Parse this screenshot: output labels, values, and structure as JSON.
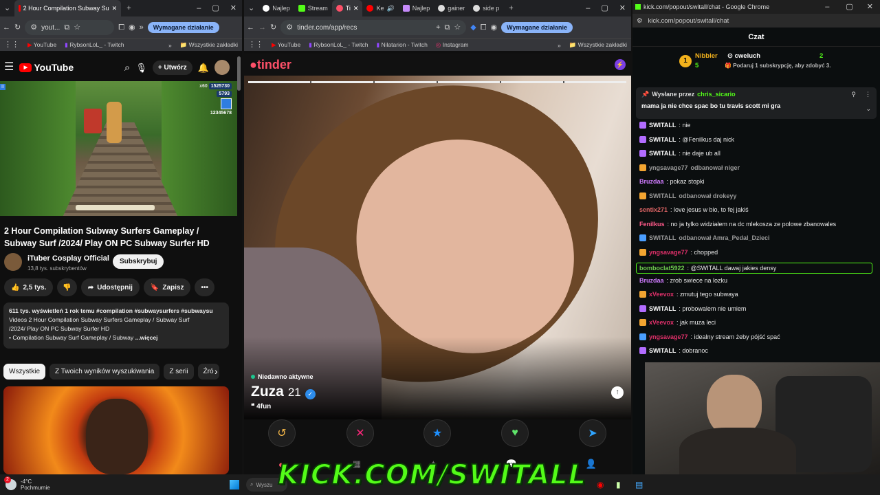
{
  "left_window": {
    "tabs": [
      {
        "label": "2 Hour Compilation Subway Su"
      }
    ],
    "address": "yout...",
    "action_button": "Wymagane działanie",
    "bookmarks": [
      "YouTube",
      "RybsonLoL_ - Twitch"
    ],
    "all_bookmarks": "Wszystkie zakładki",
    "youtube": {
      "logo": "YouTube",
      "create_label": "Utwórz",
      "video_overlay": {
        "top_score": "1525730",
        "coins": "5793",
        "score2": "12345678",
        "multiplier": "x60"
      },
      "title": "2 Hour Compilation Subway Surfers Gameplay / Subway Surf /2024/ Play ON PC Subway Surfer HD",
      "channel": "iTuber Cosplay Official",
      "subscribers": "13,8 tys. subskrybentów",
      "subscribe_label": "Subskrybuj",
      "likes": "2,5 tys.",
      "share_label": "Udostępnij",
      "save_label": "Zapisz",
      "desc_line1": "611 tys. wyświetleń  1 rok temu  #compilation #subwaysurfers #subwaysu",
      "desc_line2": "Videos 2 Hour Compilation Subway Surfers Gameplay / Subway Surf",
      "desc_line3": "/2024/ Play ON PC Subway Surfer HD",
      "desc_line4": "• Compilation Subway Surf Gameplay / Subway",
      "more_label": "...więcej",
      "chips": [
        "Wszystkie",
        "Z Twoich wyników wyszukiwania",
        "Z serii",
        "Źró"
      ]
    }
  },
  "middle_window": {
    "tabs": [
      "Najlep",
      "Stream",
      "Ti",
      "Ke",
      "Najlep",
      "gainer",
      "side p"
    ],
    "address": "tinder.com/app/recs",
    "action_button": "Wymagane działanie",
    "bookmarks": [
      "YouTube",
      "RybsonLoL_ - Twitch",
      "Nilatarion - Twitch",
      "Instagram"
    ],
    "all_bookmarks": "Wszystkie zakładki",
    "tinder": {
      "logo": "tinder",
      "status": "Niedawno aktywne",
      "name": "Zuza",
      "age": "21",
      "bio": "4fun"
    }
  },
  "right_window": {
    "title": "kick.com/popout/switall/chat - Google Chrome",
    "address": "kick.com/popout/switall/chat",
    "chat_header": "Czat",
    "leaderboard": {
      "first_name": "Nibbler",
      "first_count": "5",
      "second_name": "cweluch",
      "second_count": "2",
      "note": "Podaruj 1 subskrypcję, aby zdobyć 3."
    },
    "pinned": {
      "prefix": "Wysłane przez",
      "author": "chris_sicario",
      "text": "mama ja nie chce spac bo tu travis scott mi gra"
    },
    "messages": [
      {
        "user": "SWITALL",
        "text": ": nie",
        "color": "#ffffff",
        "badge": "#b26cff"
      },
      {
        "user": "SWITALL",
        "text": ": @Fenilkus daj nick",
        "color": "#ffffff",
        "badge": "#b26cff"
      },
      {
        "user": "SWITALL",
        "text": ": nie daje ub all",
        "color": "#ffffff",
        "badge": "#b26cff"
      },
      {
        "user": "yngsavage77",
        "text": " odbanował niger",
        "color": "#9a9a9a",
        "badge": "#f3a531",
        "system": true
      },
      {
        "user": "Bruzdaa",
        "text": ": pokaz stopki",
        "color": "#d07cff",
        "badge": ""
      },
      {
        "user": "SWITALL",
        "text": " odbanował drokeyy",
        "color": "#9a9a9a",
        "badge": "#f3a531",
        "system": true
      },
      {
        "user": "sentix271",
        "text": ": love jesus w bio, to fej jakiś",
        "color": "#e06666",
        "badge": ""
      },
      {
        "user": "Fenilkus",
        "text": ": no ja tylko widziałem na dc mlekosza ze polowe zbanowales",
        "color": "#ff5a8a",
        "badge": ""
      },
      {
        "user": "SWITALL",
        "text": " odbanował Amra_Pedal_Dzieci",
        "color": "#9a9a9a",
        "badge": "#4a9eff",
        "system": true
      },
      {
        "user": "yngsavage77",
        "text": ": chopped",
        "color": "#e0306a",
        "badge": "#f3a531"
      },
      {
        "user": "bomboclat5922",
        "text": ": @SWITALL dawaj jakies densy",
        "color": "#6fcf4f",
        "badge": "",
        "highlight": true
      },
      {
        "user": "Bruzdaa",
        "text": ": zrob swiece na lozku",
        "color": "#d07cff",
        "badge": ""
      },
      {
        "user": "xVeevox",
        "text": ": zmutuj tego subwaya",
        "color": "#e0306a",
        "badge": "#f3a531"
      },
      {
        "user": "SWITALL",
        "text": ": probowalem nie umiem",
        "color": "#ffffff",
        "badge": "#b26cff"
      },
      {
        "user": "xVeevox",
        "text": ": jak muza leci",
        "color": "#e0306a",
        "badge": "#f3a531"
      },
      {
        "user": "yngsavage77",
        "text": ": idealny stream żeby pójść spać",
        "color": "#e0306a",
        "badge": "#4a9eff"
      },
      {
        "user": "SWITALL",
        "text": ": dobranoc",
        "color": "#ffffff",
        "badge": "#b26cff"
      }
    ]
  },
  "overlay_text": "KICK.COM/SWITALL",
  "taskbar": {
    "temperature": "-4°C",
    "weather": "Pochmurnie",
    "notification_count": "2",
    "search_placeholder": "Wyszu"
  }
}
